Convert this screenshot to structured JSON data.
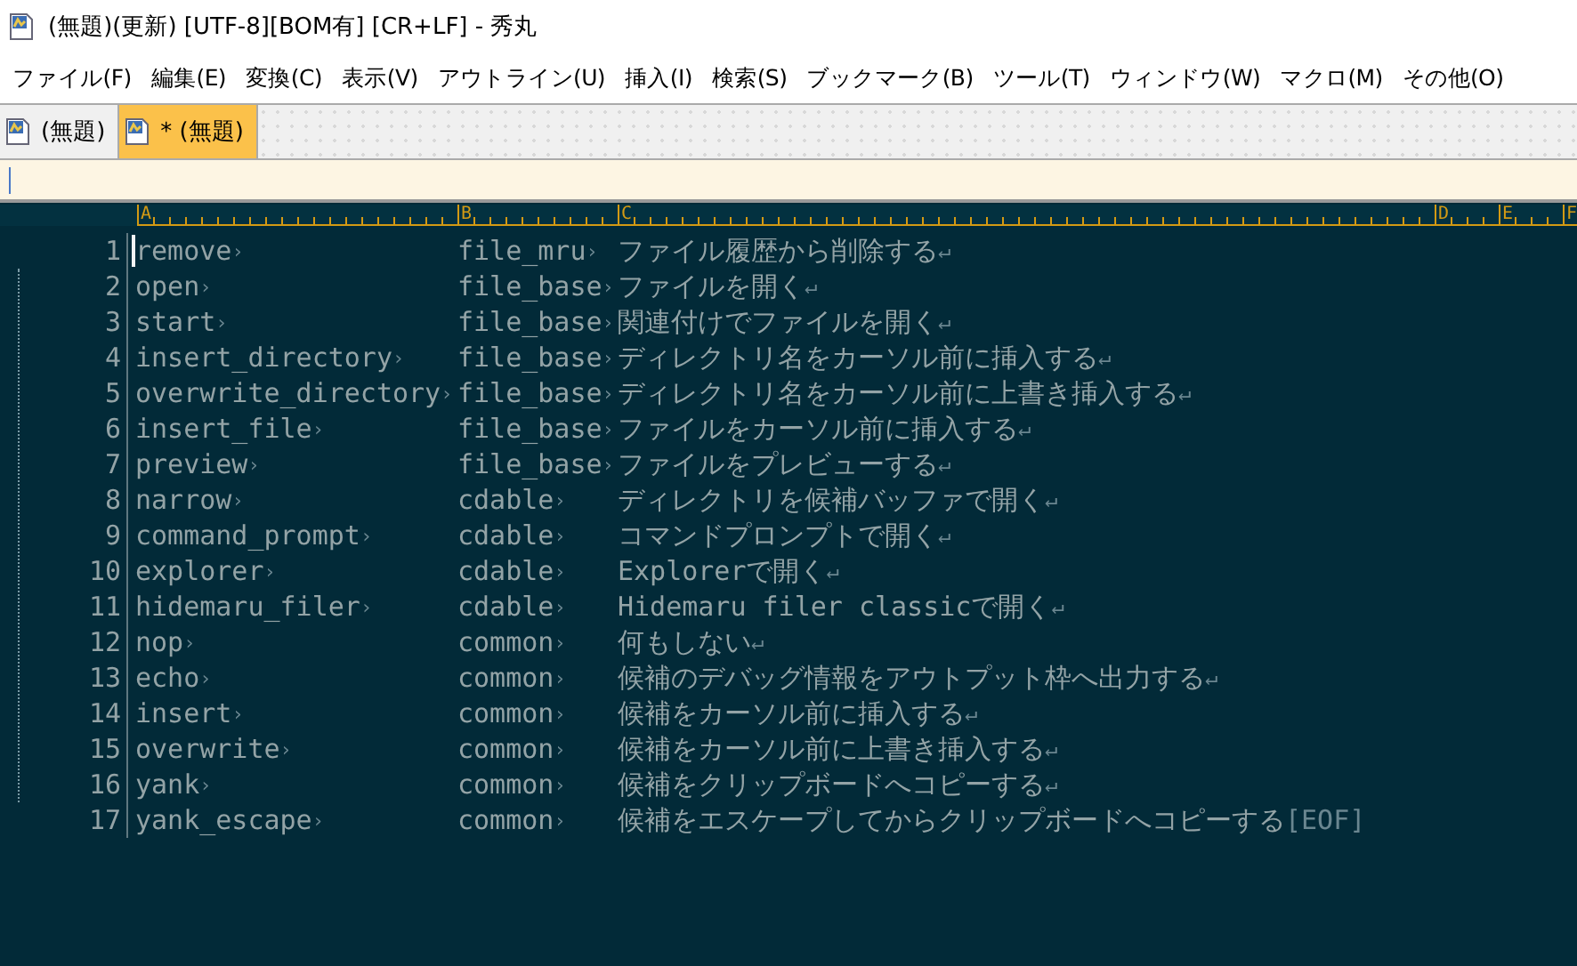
{
  "window": {
    "title": "(無題)(更新) [UTF-8][BOM有] [CR+LF] - 秀丸"
  },
  "menu": [
    "ファイル(F)",
    "編集(E)",
    "変換(C)",
    "表示(V)",
    "アウトライン(U)",
    "挿入(I)",
    "検索(S)",
    "ブックマーク(B)",
    "ツール(T)",
    "ウィンドウ(W)",
    "マクロ(M)",
    "その他(O)"
  ],
  "tabs": [
    {
      "label": "(無題)",
      "selected": false
    },
    {
      "label": "* (無題)",
      "selected": true
    }
  ],
  "ruler": [
    "A",
    "B",
    "C",
    "D",
    "E",
    "F"
  ],
  "rows": [
    {
      "number": "1",
      "name": "remove",
      "tab_1": "›",
      "group": "file_mru",
      "tab_2": "›",
      "description": "ファイル履歴から削除する",
      "end": "↵",
      "cursor": true
    },
    {
      "number": "2",
      "name": "open",
      "tab_1": "›",
      "group": "file_base",
      "tab_2": "›",
      "description": "ファイルを開く",
      "end": "↵",
      "cursor": false
    },
    {
      "number": "3",
      "name": "start",
      "tab_1": "›",
      "group": "file_base",
      "tab_2": "›",
      "description": "関連付けでファイルを開く",
      "end": "↵",
      "cursor": false
    },
    {
      "number": "4",
      "name": "insert_directory",
      "tab_1": "›",
      "group": "file_base",
      "tab_2": "›",
      "description": "ディレクトリ名をカーソル前に挿入する",
      "end": "↵",
      "cursor": false
    },
    {
      "number": "5",
      "name": "overwrite_directory",
      "tab_1": "›",
      "group": "file_base",
      "tab_2": "›",
      "description": "ディレクトリ名をカーソル前に上書き挿入する",
      "end": "↵",
      "cursor": false
    },
    {
      "number": "6",
      "name": "insert_file",
      "tab_1": "›",
      "group": "file_base",
      "tab_2": "›",
      "description": "ファイルをカーソル前に挿入する",
      "end": "↵",
      "cursor": false
    },
    {
      "number": "7",
      "name": "preview",
      "tab_1": "›",
      "group": "file_base",
      "tab_2": "›",
      "description": "ファイルをプレビューする",
      "end": "↵",
      "cursor": false
    },
    {
      "number": "8",
      "name": "narrow",
      "tab_1": "›",
      "group": "cdable",
      "tab_2": "›",
      "description": "ディレクトリを候補バッファで開く",
      "end": "↵",
      "cursor": false
    },
    {
      "number": "9",
      "name": "command_prompt",
      "tab_1": "›",
      "group": "cdable",
      "tab_2": "›",
      "description": "コマンドプロンプトで開く",
      "end": "↵",
      "cursor": false
    },
    {
      "number": "10",
      "name": "explorer",
      "tab_1": "›",
      "group": "cdable",
      "tab_2": "›",
      "description": "Explorerで開く",
      "end": "↵",
      "cursor": false
    },
    {
      "number": "11",
      "name": "hidemaru_filer",
      "tab_1": "›",
      "group": "cdable",
      "tab_2": "›",
      "description": "Hidemaru filer classicで開く",
      "end": "↵",
      "cursor": false
    },
    {
      "number": "12",
      "name": "nop",
      "tab_1": "›",
      "group": "common",
      "tab_2": "›",
      "description": "何もしない",
      "end": "↵",
      "cursor": false
    },
    {
      "number": "13",
      "name": "echo",
      "tab_1": "›",
      "group": "common",
      "tab_2": "›",
      "description": "候補のデバッグ情報をアウトプット枠へ出力する",
      "end": "↵",
      "cursor": false
    },
    {
      "number": "14",
      "name": "insert",
      "tab_1": "›",
      "group": "common",
      "tab_2": "›",
      "description": "候補をカーソル前に挿入する",
      "end": "↵",
      "cursor": false
    },
    {
      "number": "15",
      "name": "overwrite",
      "tab_1": "›",
      "group": "common",
      "tab_2": "›",
      "description": "候補をカーソル前に上書き挿入する",
      "end": "↵",
      "cursor": false
    },
    {
      "number": "16",
      "name": "yank",
      "tab_1": "›",
      "group": "common",
      "tab_2": "›",
      "description": "候補をクリップボードへコピーする",
      "end": "↵",
      "cursor": false
    },
    {
      "number": "17",
      "name": "yank_escape",
      "tab_1": "›",
      "group": "common",
      "tab_2": "›",
      "description": "候補をエスケープしてからクリップボードへコピーする",
      "end": "[EOF]",
      "cursor": false
    }
  ]
}
